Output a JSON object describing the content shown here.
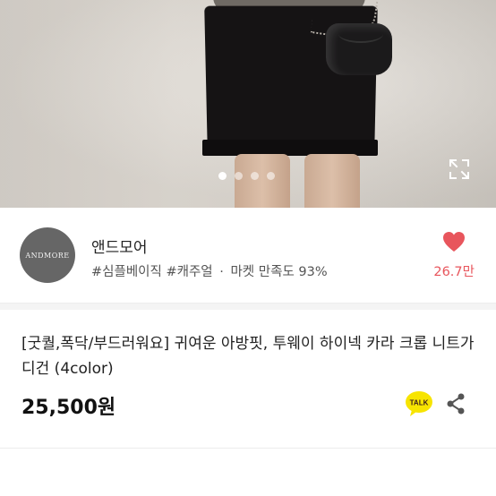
{
  "gallery": {
    "image_alt": "",
    "dot_count": 4,
    "active_index": 0
  },
  "store": {
    "logo_text": "ANDMORE",
    "name": "앤드모어",
    "tag1": "#심플베이직",
    "tag2": "#캐주얼",
    "separator": "·",
    "satisfaction": "마켓 만족도 93%",
    "like_count": "26.7만"
  },
  "product": {
    "title": "[굿퀄,폭닥/부드러워요] 귀여운 아방핏, 투웨이 하이넥 카라 크롭 니트가디건 (4color)",
    "price": "25,500원"
  },
  "icons": {
    "expand": "expand-icon",
    "heart": "heart-icon",
    "talk": "kakao-talk-icon",
    "share": "share-icon",
    "talk_label": "TALK"
  },
  "colors": {
    "heart": "#e8555c",
    "talk_bg": "#f7e400",
    "text": "#222222"
  }
}
